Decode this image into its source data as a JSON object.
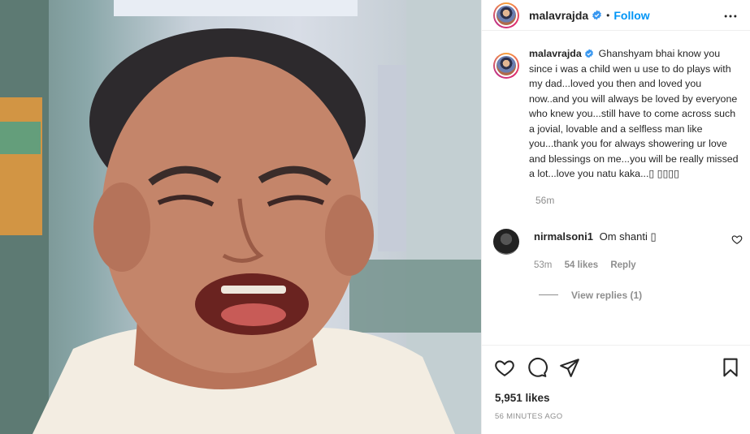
{
  "post": {
    "image_alt": "smiling man with glasses-less face and open mouth",
    "author": "malavrajda",
    "follow_label": "Follow",
    "separator": "•",
    "caption": "Ghanshyam bhai know you since i was a child wen u use to do plays with my dad...loved you then and loved you now..and you will always be loved by everyone who knew you...still have to come across such a jovial, lovable and a selfless man like you...thank you for always showering ur love and blessings on me...you will be really missed a lot...love you natu kaka...▯ ▯▯▯▯",
    "caption_time": "56m",
    "likes": "5,951 likes",
    "posted_time": "56 MINUTES AGO"
  },
  "comments": [
    {
      "user": "nirmalsoni1",
      "text": "Om shanti ▯",
      "time": "53m",
      "likes": "54 likes",
      "reply_label": "Reply"
    }
  ],
  "view_replies_label": "View replies (1)",
  "icons": {
    "more": "more-options-icon",
    "verified": "verified-badge-icon",
    "like": "heart-icon",
    "comment": "comment-icon",
    "share": "share-icon",
    "save": "bookmark-icon",
    "comment_like": "small-heart-icon"
  },
  "colors": {
    "link": "#0095f6",
    "verified": "#3897f0",
    "muted": "#8e8e8e",
    "text": "#262626"
  }
}
